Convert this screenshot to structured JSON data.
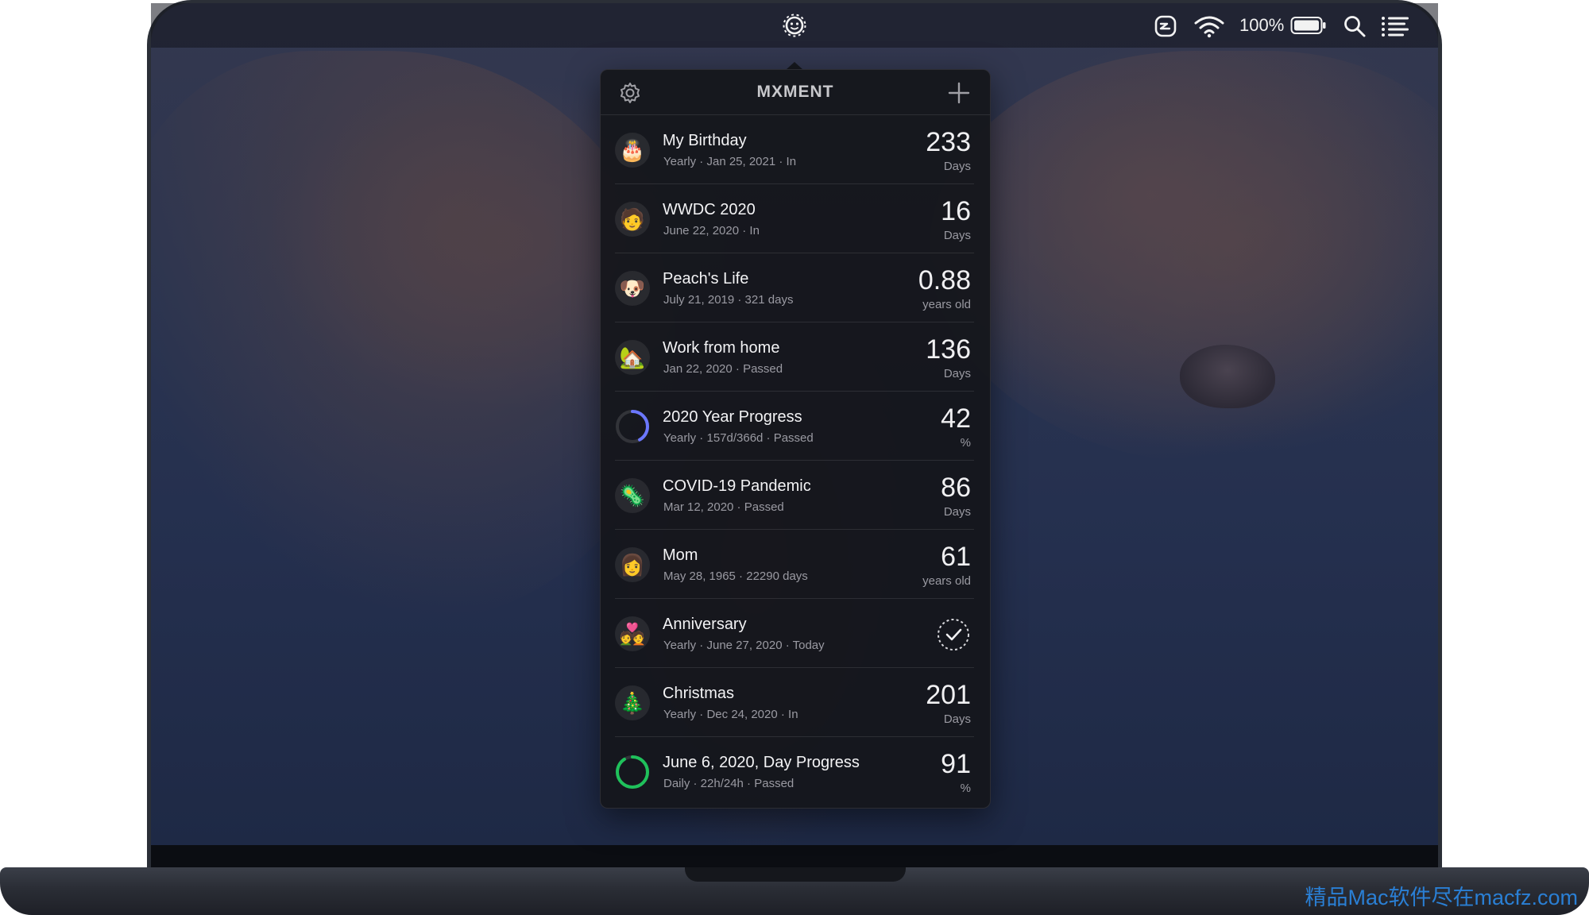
{
  "menubar": {
    "battery_percent": "100%",
    "icons": [
      "moment-status-icon",
      "app-status-icon",
      "wifi-icon",
      "battery-icon",
      "search-icon",
      "list-icon"
    ]
  },
  "popover": {
    "title": "MXMENT",
    "items": [
      {
        "title": "My Birthday",
        "subtitle": "Yearly · Jan 25, 2021 · In",
        "value": "233",
        "unit": "Days",
        "icon": "cake-icon",
        "icon_glyph": "🎂"
      },
      {
        "title": "WWDC 2020",
        "subtitle": "June 22, 2020 · In",
        "value": "16",
        "unit": "Days",
        "icon": "wwdc-memoji-icon",
        "icon_glyph": "🧑"
      },
      {
        "title": "Peach's Life",
        "subtitle": "July 21, 2019 · 321 days",
        "value": "0.88",
        "unit": "years old",
        "icon": "dog-photo-icon",
        "icon_glyph": "🐶"
      },
      {
        "title": "Work from home",
        "subtitle": "Jan 22, 2020 · Passed",
        "value": "136",
        "unit": "Days",
        "icon": "house-icon",
        "icon_glyph": "🏡"
      },
      {
        "title": "2020 Year Progress",
        "subtitle": "Yearly · 157d/366d · Passed",
        "value": "42",
        "unit": "%",
        "icon": "progress-ring-icon",
        "progress": 0.42,
        "ring_color": "#6b77ff"
      },
      {
        "title": "COVID-19 Pandemic",
        "subtitle": "Mar 12, 2020 · Passed",
        "value": "86",
        "unit": "Days",
        "icon": "virus-icon",
        "icon_glyph": "🦠"
      },
      {
        "title": "Mom",
        "subtitle": "May 28, 1965 · 22290 days",
        "value": "61",
        "unit": "years old",
        "icon": "mom-avatar-icon",
        "icon_glyph": "👩"
      },
      {
        "title": "Anniversary",
        "subtitle": "Yearly · June 27, 2020 · Today",
        "value": "",
        "unit": "",
        "icon": "couple-icon",
        "icon_glyph": "💑",
        "done": true
      },
      {
        "title": "Christmas",
        "subtitle": "Yearly · Dec 24, 2020 · In",
        "value": "201",
        "unit": "Days",
        "icon": "christmas-tree-icon",
        "icon_glyph": "🎄"
      },
      {
        "title": "June 6, 2020, Day Progress",
        "subtitle": "Daily · 22h/24h · Passed",
        "value": "91",
        "unit": "%",
        "icon": "progress-ring-icon",
        "progress": 0.91,
        "ring_color": "#1fc15b"
      }
    ]
  },
  "watermark": "精品Mac软件尽在macfz.com"
}
